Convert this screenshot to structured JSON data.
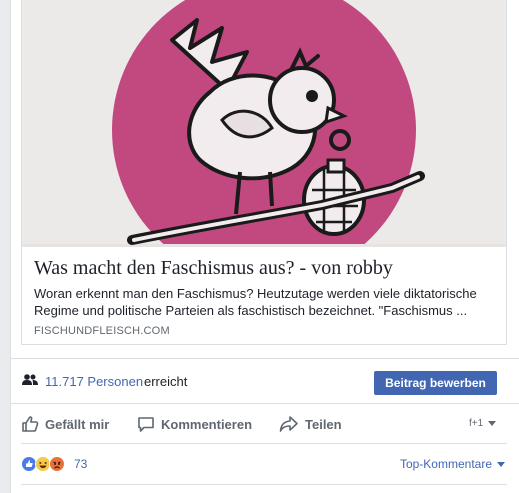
{
  "link_preview": {
    "title": "Was macht den Faschismus aus? - von robby",
    "description": "Woran erkennt man den Faschismus? Heutzutage werden viele diktatorische Regime und politische Parteien als faschistisch bezeichnet. \"Faschismus ...",
    "domain": "FISCHUNDFLEISCH.COM",
    "image_icon": "pink-circle-bird-with-grenade-illustration"
  },
  "reach": {
    "count_text": "11.717 Personen",
    "suffix": "erreicht",
    "boost_label": "Beitrag bewerben"
  },
  "actions": {
    "like": "Gefällt mir",
    "comment": "Kommentieren",
    "share": "Teilen",
    "share_as": "f+1"
  },
  "reactions": {
    "count": "73",
    "sort_label": "Top-Kommentare"
  },
  "colors": {
    "accent": "#4267b2",
    "muted": "#606770",
    "pink": "#c2497f"
  }
}
